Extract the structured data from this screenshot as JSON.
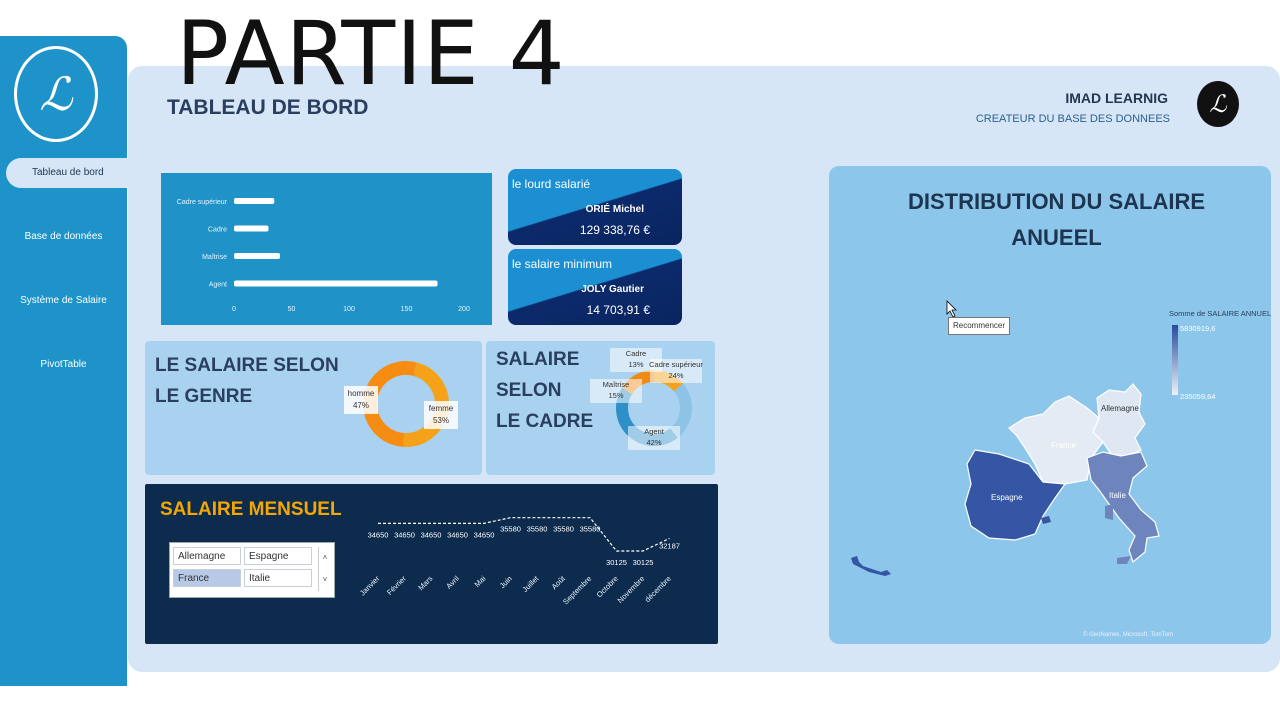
{
  "overlay_title": "PARTIE 4",
  "sidebar": {
    "items": [
      {
        "label": "Tableau de bord"
      },
      {
        "label": "Base de données"
      },
      {
        "label": "Système de Salaire"
      },
      {
        "label": "PivotTable"
      }
    ]
  },
  "header": {
    "title": "TABLEAU DE BORD",
    "brand": "IMAD LEARNIG",
    "brand_sub": "CREATEUR DU BASE DES DONNEES",
    "logo_text": "IL"
  },
  "bar_chart": {
    "chart_data": {
      "type": "bar",
      "categories": [
        "Cadre supérieur",
        "Cadre",
        "Maîtrise",
        "Agent"
      ],
      "values": [
        35,
        30,
        40,
        177
      ],
      "xlim": [
        0,
        200
      ],
      "xticks": [
        "0",
        "50",
        "100",
        "150",
        "200"
      ]
    }
  },
  "cards": {
    "max_salary": {
      "title": "le lourd salarié",
      "name": "ORIÉ Michel",
      "value": "129 338,76 €"
    },
    "min_salary": {
      "title": "le salaire minimum",
      "name": "JOLY Gautier",
      "value": "14 703,91 €"
    }
  },
  "gender": {
    "title_line1": "LE SALAIRE SELON",
    "title_line2": "LE GENRE",
    "chart_data": {
      "type": "pie",
      "labels": [
        "homme",
        "femme"
      ],
      "values": [
        47,
        53
      ],
      "display": [
        "47%",
        "53%"
      ]
    }
  },
  "cadre": {
    "title_line1": "SALAIRE",
    "title_line2": "SELON",
    "title_line3": "LE CADRE",
    "chart_data": {
      "type": "pie",
      "labels": [
        "Cadre",
        "Cadre supérieur",
        "Agent",
        "Maîtrise"
      ],
      "values": [
        13,
        24,
        42,
        15
      ],
      "display": [
        "13%",
        "24%",
        "42%",
        "15%"
      ]
    }
  },
  "monthly": {
    "title": "SALAIRE MENSUEL",
    "slicer": [
      "Allemagne",
      "Espagne",
      "France",
      "Italie"
    ],
    "selected": "France",
    "chart_data": {
      "type": "line",
      "x": [
        "Janvier",
        "Février",
        "Mars",
        "Avril",
        "Mai",
        "Juin",
        "Juillet",
        "Août",
        "Septembre",
        "Octobre",
        "Novembre",
        "décembre"
      ],
      "values": [
        34650,
        34650,
        34650,
        34650,
        34650,
        35580,
        35580,
        35580,
        35580,
        30125,
        30125,
        32187
      ],
      "labels": [
        "34650",
        "34650",
        "34650",
        "34650",
        "34650",
        "35580",
        "35580",
        "35580",
        "35580",
        "30125",
        "30125",
        "32187"
      ]
    }
  },
  "map": {
    "title_line1": "DISTRIBUTION DU SALAIRE",
    "title_line2": "ANUEEL",
    "tooltip": "Recommencer",
    "legend_title": "Somme de SALAIRE ANNUEL",
    "legend_max": "5830919,6",
    "legend_min": "235059,64",
    "countries": [
      "Allemagne",
      "France",
      "Espagne",
      "Italie"
    ],
    "credit": "© GeoNames, Microsoft, TomTom",
    "colors": {
      "Allemagne": "#dfe7f2",
      "France": "#e5ebf4",
      "Espagne": "#3556a4",
      "Italie": "#6d84bd"
    }
  }
}
